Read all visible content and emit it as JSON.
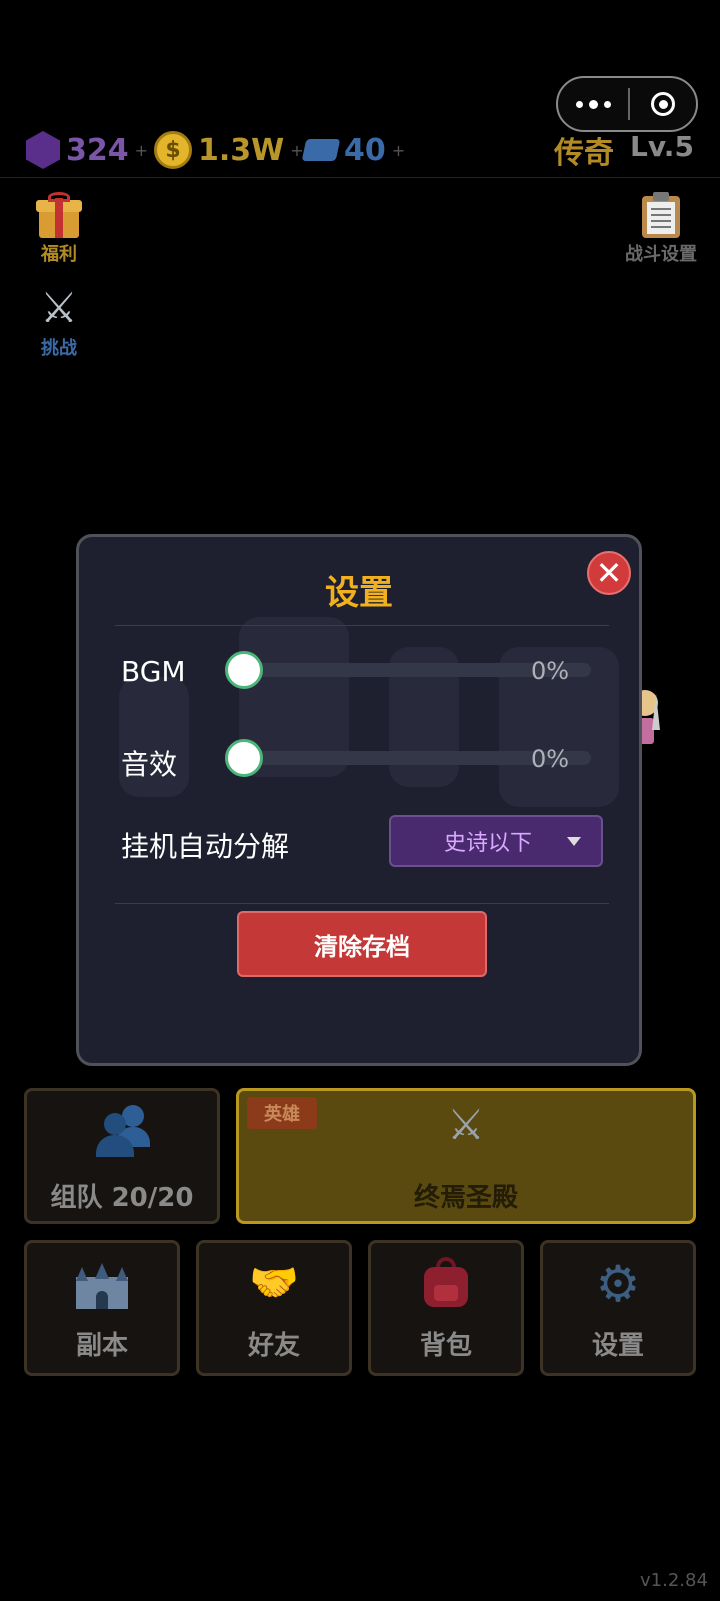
{
  "resources": {
    "gems": "324",
    "gold": "1.3W",
    "tickets": "40",
    "plus": "+"
  },
  "rank": {
    "title": "传奇",
    "level": "Lv.5"
  },
  "coin_symbol": "$",
  "side": {
    "welfare": "福利",
    "challenge": "挑战",
    "battle_settings": "战斗设置"
  },
  "dialog": {
    "title": "设置",
    "bgm_label": "BGM",
    "bgm_value": "0%",
    "bgm_level": 0,
    "sfx_label": "音效",
    "sfx_value": "0%",
    "sfx_level": 0,
    "auto_decompose_label": "挂机自动分解",
    "auto_decompose_value": "史诗以下",
    "clear_save": "清除存档"
  },
  "bottom": {
    "team": "组队 20/20",
    "hero_tag": "英雄",
    "boss": "终焉圣殿",
    "dungeon": "副本",
    "friends": "好友",
    "bag": "背包",
    "settings": "设置"
  },
  "version": "v1.2.84",
  "colors": {
    "accent_gold": "#f0b020",
    "danger": "#c53838",
    "dialog_bg": "#1e2030",
    "epic_purple": "#4a2a6e"
  }
}
